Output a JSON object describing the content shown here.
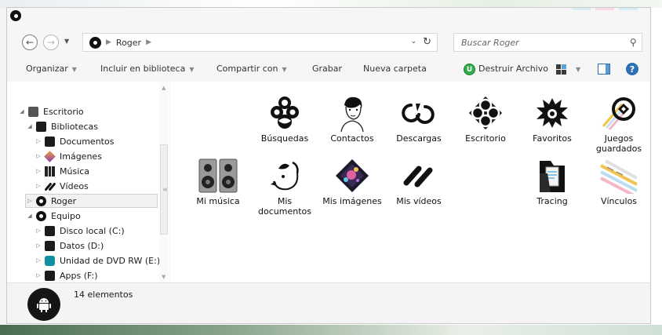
{
  "window": {
    "accent_colors": [
      "#d9eef3",
      "#fbd9e2",
      "#d6ecf6"
    ]
  },
  "address": {
    "location": "Roger"
  },
  "search": {
    "placeholder": "Buscar Roger"
  },
  "toolbar": {
    "organize": "Organizar",
    "include_library": "Incluir en biblioteca",
    "share_with": "Compartir con",
    "burn": "Grabar",
    "new_folder": "Nueva carpeta",
    "destroy_file": "Destruir Archivo",
    "destroy_icon_letter": "U"
  },
  "nav_tree": [
    {
      "label": "Escritorio",
      "icon": "desktop-icon",
      "expanded": true
    },
    {
      "label": "Bibliotecas",
      "icon": "libraries-icon",
      "expanded": true
    },
    {
      "label": "Documentos",
      "icon": "documents-icon",
      "expanded": false
    },
    {
      "label": "Imágenes",
      "icon": "pictures-icon",
      "expanded": false
    },
    {
      "label": "Música",
      "icon": "music-icon",
      "expanded": false
    },
    {
      "label": "Vídeos",
      "icon": "videos-icon",
      "expanded": false
    },
    {
      "label": "Roger",
      "icon": "user-folder-icon",
      "expanded": false,
      "selected": true
    },
    {
      "label": "Equipo",
      "icon": "computer-icon",
      "expanded": true
    },
    {
      "label": "Disco local (C:)",
      "icon": "local-disk-icon",
      "expanded": false
    },
    {
      "label": "Datos (D:)",
      "icon": "data-drive-icon",
      "expanded": false
    },
    {
      "label": "Unidad de DVD RW (E:)",
      "icon": "dvd-drive-icon",
      "expanded": false
    },
    {
      "label": "Apps (F:)",
      "icon": "apps-drive-icon",
      "expanded": false
    }
  ],
  "items": [
    {
      "label": "Búsquedas",
      "icon": "searches-icon"
    },
    {
      "label": "Contactos",
      "icon": "contacts-icon"
    },
    {
      "label": "Descargas",
      "icon": "downloads-icon"
    },
    {
      "label": "Escritorio",
      "icon": "desktop-folder-icon"
    },
    {
      "label": "Favoritos",
      "icon": "favorites-icon"
    },
    {
      "label": "Juegos guardados",
      "icon": "saved-games-icon"
    },
    {
      "label": "Mi música",
      "icon": "my-music-icon"
    },
    {
      "label": "Mis documentos",
      "icon": "my-documents-icon"
    },
    {
      "label": "Mis imágenes",
      "icon": "my-pictures-icon"
    },
    {
      "label": "Mis vídeos",
      "icon": "my-videos-icon"
    },
    {
      "label": "Tracing",
      "icon": "tracing-folder-icon"
    },
    {
      "label": "Vínculos",
      "icon": "links-icon"
    }
  ],
  "status": {
    "item_count": "14 elementos"
  }
}
